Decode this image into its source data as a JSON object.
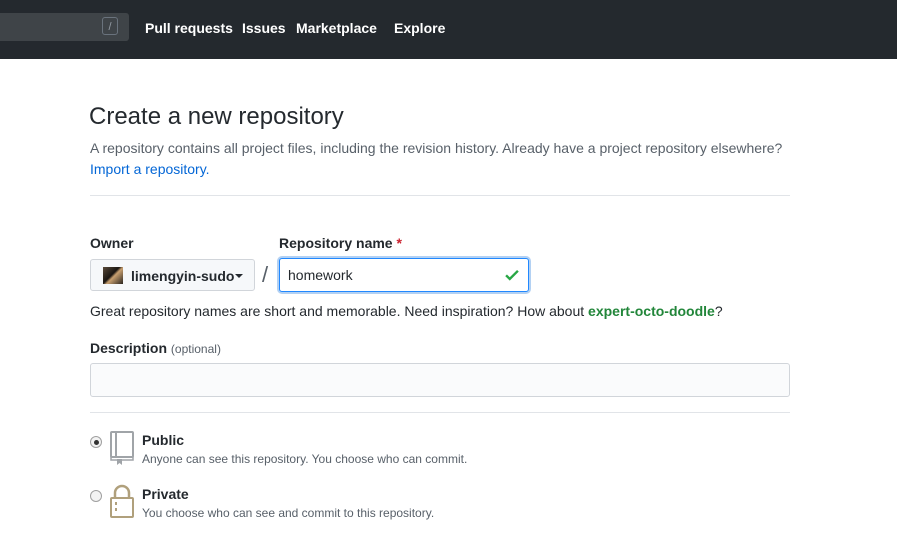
{
  "header": {
    "search_shortcut": "/",
    "nav": [
      "Pull requests",
      "Issues",
      "Marketplace",
      "Explore"
    ]
  },
  "page": {
    "title": "Create a new repository",
    "subtitle": "A repository contains all project files, including the revision history. Already have a project repository elsewhere?",
    "import_link": "Import a repository."
  },
  "form": {
    "owner_label": "Owner",
    "owner_value": "limengyin-sudo",
    "repo_label": "Repository name",
    "required_mark": "*",
    "repo_value": "homework",
    "separator": "/",
    "hint_prefix": "Great repository names are short and memorable. Need inspiration? How about ",
    "hint_suggestion": "expert-octo-doodle",
    "hint_suffix": "?",
    "description_label": "Description",
    "description_optional": "(optional)",
    "description_value": ""
  },
  "visibility": {
    "public": {
      "title": "Public",
      "desc": "Anyone can see this repository. You choose who can commit.",
      "selected": true
    },
    "private": {
      "title": "Private",
      "desc": "You choose who can see and commit to this repository.",
      "selected": false
    }
  },
  "colors": {
    "header_bg": "#24292e",
    "link": "#0366d6",
    "success": "#28a745",
    "required": "#cb2431",
    "icon_gold": "#b0a07c"
  }
}
